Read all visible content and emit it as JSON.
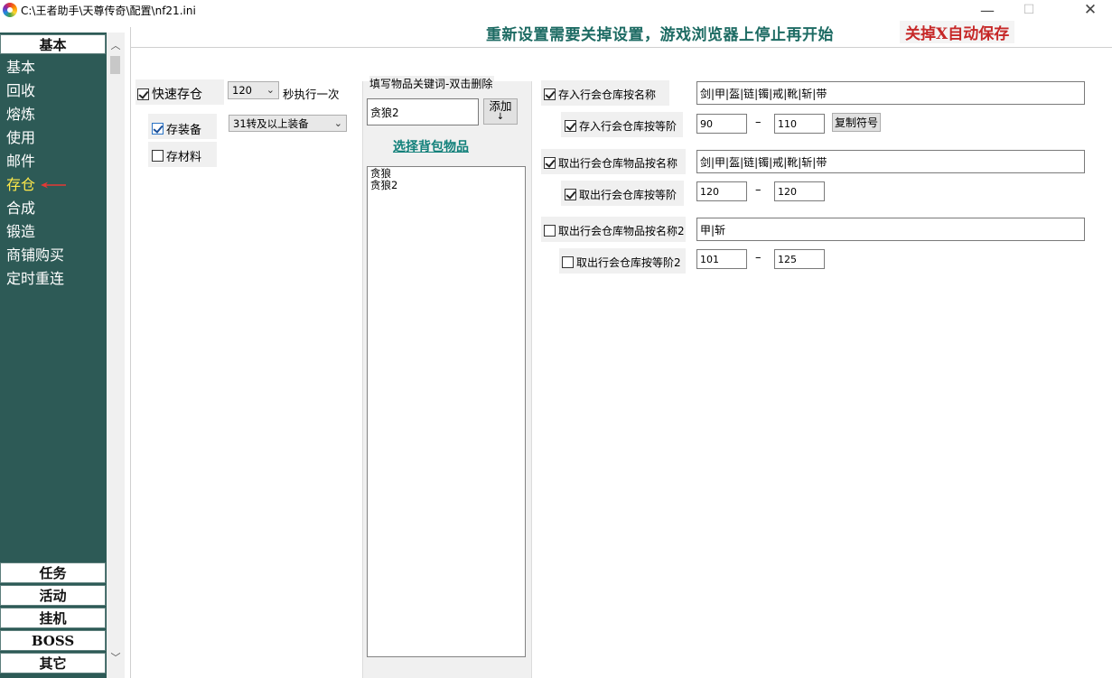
{
  "window": {
    "title": "C:\\王者助手\\天尊传奇\\配置\\nf21.ini",
    "minimize": "—",
    "maximize": "☐",
    "close": "✕"
  },
  "nav": {
    "top_button": "基本",
    "items": [
      {
        "label": "基本"
      },
      {
        "label": "回收"
      },
      {
        "label": "熔炼"
      },
      {
        "label": "使用"
      },
      {
        "label": "邮件"
      },
      {
        "label": "存仓"
      },
      {
        "label": "合成"
      },
      {
        "label": "锻造"
      },
      {
        "label": "商铺购买"
      },
      {
        "label": "定时重连"
      }
    ],
    "active_index": 5,
    "bottom_buttons": [
      "任务",
      "活动",
      "挂机",
      "BOSS",
      "其它"
    ]
  },
  "notice": {
    "line1": "重新设置需要关掉设置，游戏浏览器上停止再开始",
    "line2": "关掉X自动保存"
  },
  "quick_store": {
    "label": "快速存仓",
    "checked": true,
    "interval_value": "120",
    "interval_suffix": "秒执行一次",
    "store_equip_label": "存装备",
    "store_equip_checked": true,
    "equip_filter_value": "31转及以上装备",
    "store_material_label": "存材料",
    "store_material_checked": false
  },
  "keyword_group": {
    "title": "填写物品关键词-双击删除",
    "input_value": "贪狼2",
    "add_button": "添加",
    "add_button_arrow": "↓",
    "select_bag_link": "选择背包物品",
    "items": [
      "贪狼",
      "贪狼2"
    ]
  },
  "guild_store": {
    "deposit_by_name": {
      "label": "存入行会仓库按名称",
      "checked": true,
      "value": "剑|甲|盔|链|镯|戒|靴|斩|带"
    },
    "deposit_by_level": {
      "label": "存入行会仓库按等阶",
      "checked": true,
      "min": "90",
      "max": "110"
    },
    "copy_symbol_button": "复制符号",
    "withdraw_by_name": {
      "label": "取出行会仓库物品按名称",
      "checked": true,
      "value": "剑|甲|盔|链|镯|戒|靴|斩|带"
    },
    "withdraw_by_level": {
      "label": "取出行会仓库按等阶",
      "checked": true,
      "min": "120",
      "max": "120"
    },
    "withdraw_by_name2": {
      "label": "取出行会仓库物品按名称2",
      "checked": false,
      "value": "甲|斩"
    },
    "withdraw_by_level2": {
      "label": "取出行会仓库按等阶2",
      "checked": false,
      "min": "101",
      "max": "125"
    },
    "range_separator": "–"
  },
  "colors": {
    "nav_bg": "#2d5a56",
    "active_nav": "#ffe94a",
    "notice_teal": "#1d6b63",
    "notice_red": "#c62828",
    "link_teal": "#11807a"
  }
}
